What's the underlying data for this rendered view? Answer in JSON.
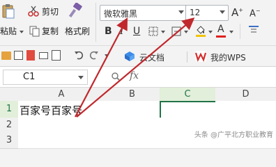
{
  "ribbon": {
    "cut_label": "剪切",
    "paste_label": "粘贴",
    "copy_label": "复制",
    "format_painter_label": "格式刷",
    "font_name": "微软雅黑",
    "font_size": "12",
    "bold": "B",
    "italic": "I",
    "underline": "U",
    "grow_font": "A",
    "shrink_font": "A",
    "font_color_letter": "A"
  },
  "tabs": {
    "cloud_doc": "云文档",
    "my_wps": "我的WPS"
  },
  "formula_bar": {
    "name_box": "C1",
    "fx": "fx"
  },
  "sheet": {
    "columns": [
      "A",
      "B",
      "C",
      "D"
    ],
    "rows": [
      "1",
      "2",
      "3"
    ],
    "a1": "百家号百家号"
  },
  "watermark": "头条 @广平北方职业教育",
  "colors": {
    "accent_green": "#217346",
    "arrow_red": "#c0282d",
    "brand_red": "#d32f2f"
  }
}
